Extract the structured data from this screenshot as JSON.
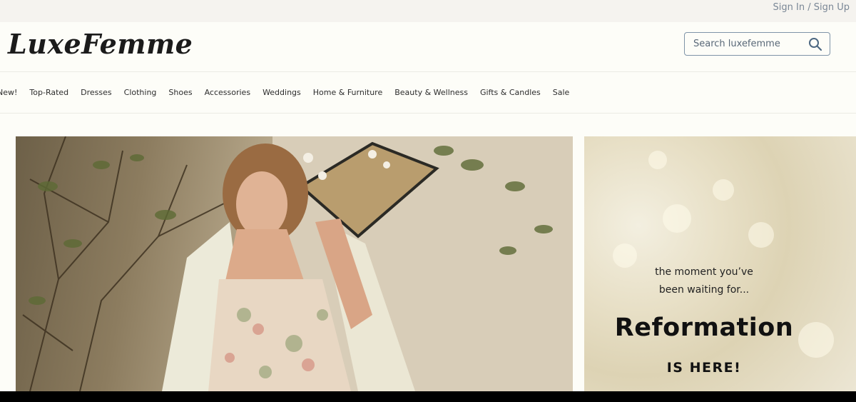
{
  "topbar": {
    "auth_label": "Sign In / Sign Up"
  },
  "header": {
    "logo": "LuxeFemme",
    "search": {
      "placeholder": "Search luxefemme",
      "value": "",
      "icon": "search-icon"
    }
  },
  "nav": {
    "items": [
      {
        "label": "New!"
      },
      {
        "label": "Top-Rated"
      },
      {
        "label": "Dresses"
      },
      {
        "label": "Clothing"
      },
      {
        "label": "Shoes"
      },
      {
        "label": "Accessories"
      },
      {
        "label": "Weddings"
      },
      {
        "label": "Home & Furniture"
      },
      {
        "label": "Beauty & Wellness"
      },
      {
        "label": "Gifts & Candles"
      },
      {
        "label": "Sale"
      }
    ]
  },
  "hero": {
    "subject": "woman-in-floral-dress-photo"
  },
  "promo": {
    "subtitle_line1": "the moment you’ve",
    "subtitle_line2": "been waiting for...",
    "title": "Reformation",
    "tagline": "IS HERE!"
  },
  "colors": {
    "page_bg": "#fdfdf8",
    "topbar_bg": "#f5f3ef",
    "link_gray": "#7a8796",
    "search_border": "#7f94a8"
  }
}
